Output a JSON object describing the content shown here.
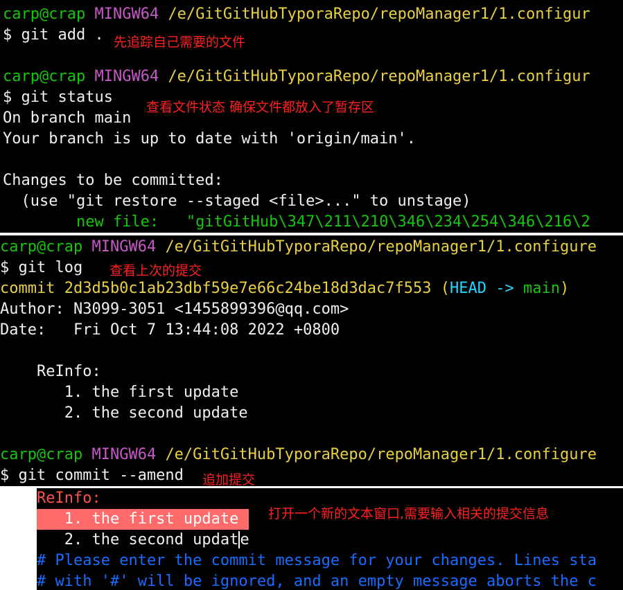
{
  "colors": {
    "prompt_user": "#16c60c",
    "prompt_system": "#c858c8",
    "prompt_path": "#e8d040",
    "annotation": "#ff2020",
    "head_ref": "#20d8ff",
    "vim_header": "#ff5050",
    "vim_comment": "#1a6cff",
    "highlight": "#ff6a6a"
  },
  "block1": {
    "prompt_user": "carp@crap",
    "prompt_system": "MINGW64",
    "prompt_path": "/e/GitGitHubTyporaRepo/repoManager1/1.configur",
    "command": "$ git add .",
    "annotation": "先追踪自己需要的文件"
  },
  "block2": {
    "prompt_user": "carp@crap",
    "prompt_system": "MINGW64",
    "prompt_path": "/e/GitGitHubTyporaRepo/repoManager1/1.configur",
    "command": "$ git status",
    "annotation": "查看文件状态 确保文件都放入了暂存区",
    "output": [
      "On branch main",
      "Your branch is up to date with 'origin/main'.",
      "",
      "Changes to be committed:",
      "  (use \"git restore --staged <file>...\" to unstage)"
    ],
    "new_file_label": "        new file:",
    "new_file_value": "\"gitGitHub\\347\\211\\210\\346\\234\\254\\346\\216\\2"
  },
  "block3": {
    "prompt_user": "carp@crap",
    "prompt_system": "MINGW64",
    "prompt_path": "/e/GitGitHubTyporaRepo/repoManager1/1.configure",
    "command": "$ git log",
    "annotation": "查看上次的提交",
    "commit_prefix": "commit 2d3d5b0c1ab23dbf59e7e66c24be18d3dac7f553",
    "head_open": "(",
    "head_ref": "HEAD ->",
    "head_branch": "main",
    "head_close": ")",
    "author": "Author: N3099-3051 <1455899396@qq.com>",
    "date": "Date:   Fri Oct 7 13:44:08 2022 +0800",
    "message": [
      "    ReInfo:",
      "       1. the first update",
      "       2. the second update"
    ]
  },
  "block4": {
    "prompt_user": "carp@crap",
    "prompt_system": "MINGW64",
    "prompt_path": "/e/GitGitHubTyporaRepo/repoManager1/1.configure",
    "command": "$ git commit --amend",
    "annotation": "追加提交"
  },
  "vim": {
    "header": "ReInfo:",
    "line1": "   1. the first update",
    "line2_before_cursor": "   2. the second updat",
    "line2_cursor_char": "e",
    "comment1": "# Please enter the commit message for your changes. Lines sta",
    "comment2": "# with '#' will be ignored, and an empty message aborts the c",
    "annotation": "打开一个新的文本窗口,需要输入相关的提交信息"
  }
}
